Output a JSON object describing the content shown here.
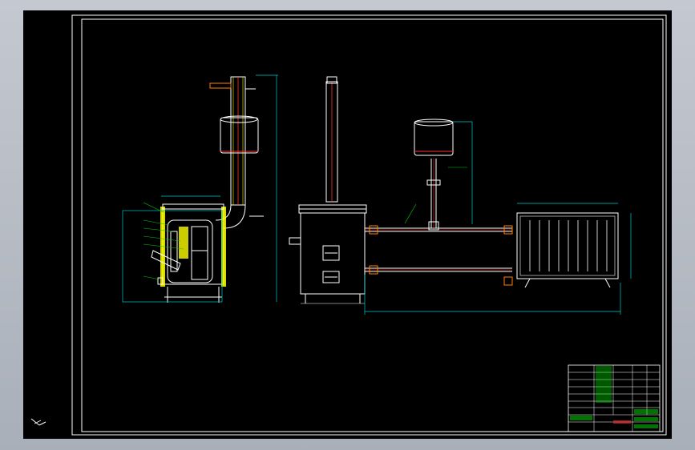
{
  "colors": {
    "background": "#000000",
    "frame": "#ffffff",
    "dimension": "#00c8c8",
    "pipe_center": "#ff3030",
    "insulation": "#ffff00",
    "table_text": "#00ff00",
    "leader": "#00c800",
    "valve": "#ff8000"
  },
  "title_block": {
    "cells": [
      "",
      "",
      "",
      "",
      ""
    ]
  },
  "icons": [
    "ucs-axis-icon",
    "valve-icon",
    "radiator-icon",
    "water-tank-icon",
    "chimney-icon"
  ]
}
